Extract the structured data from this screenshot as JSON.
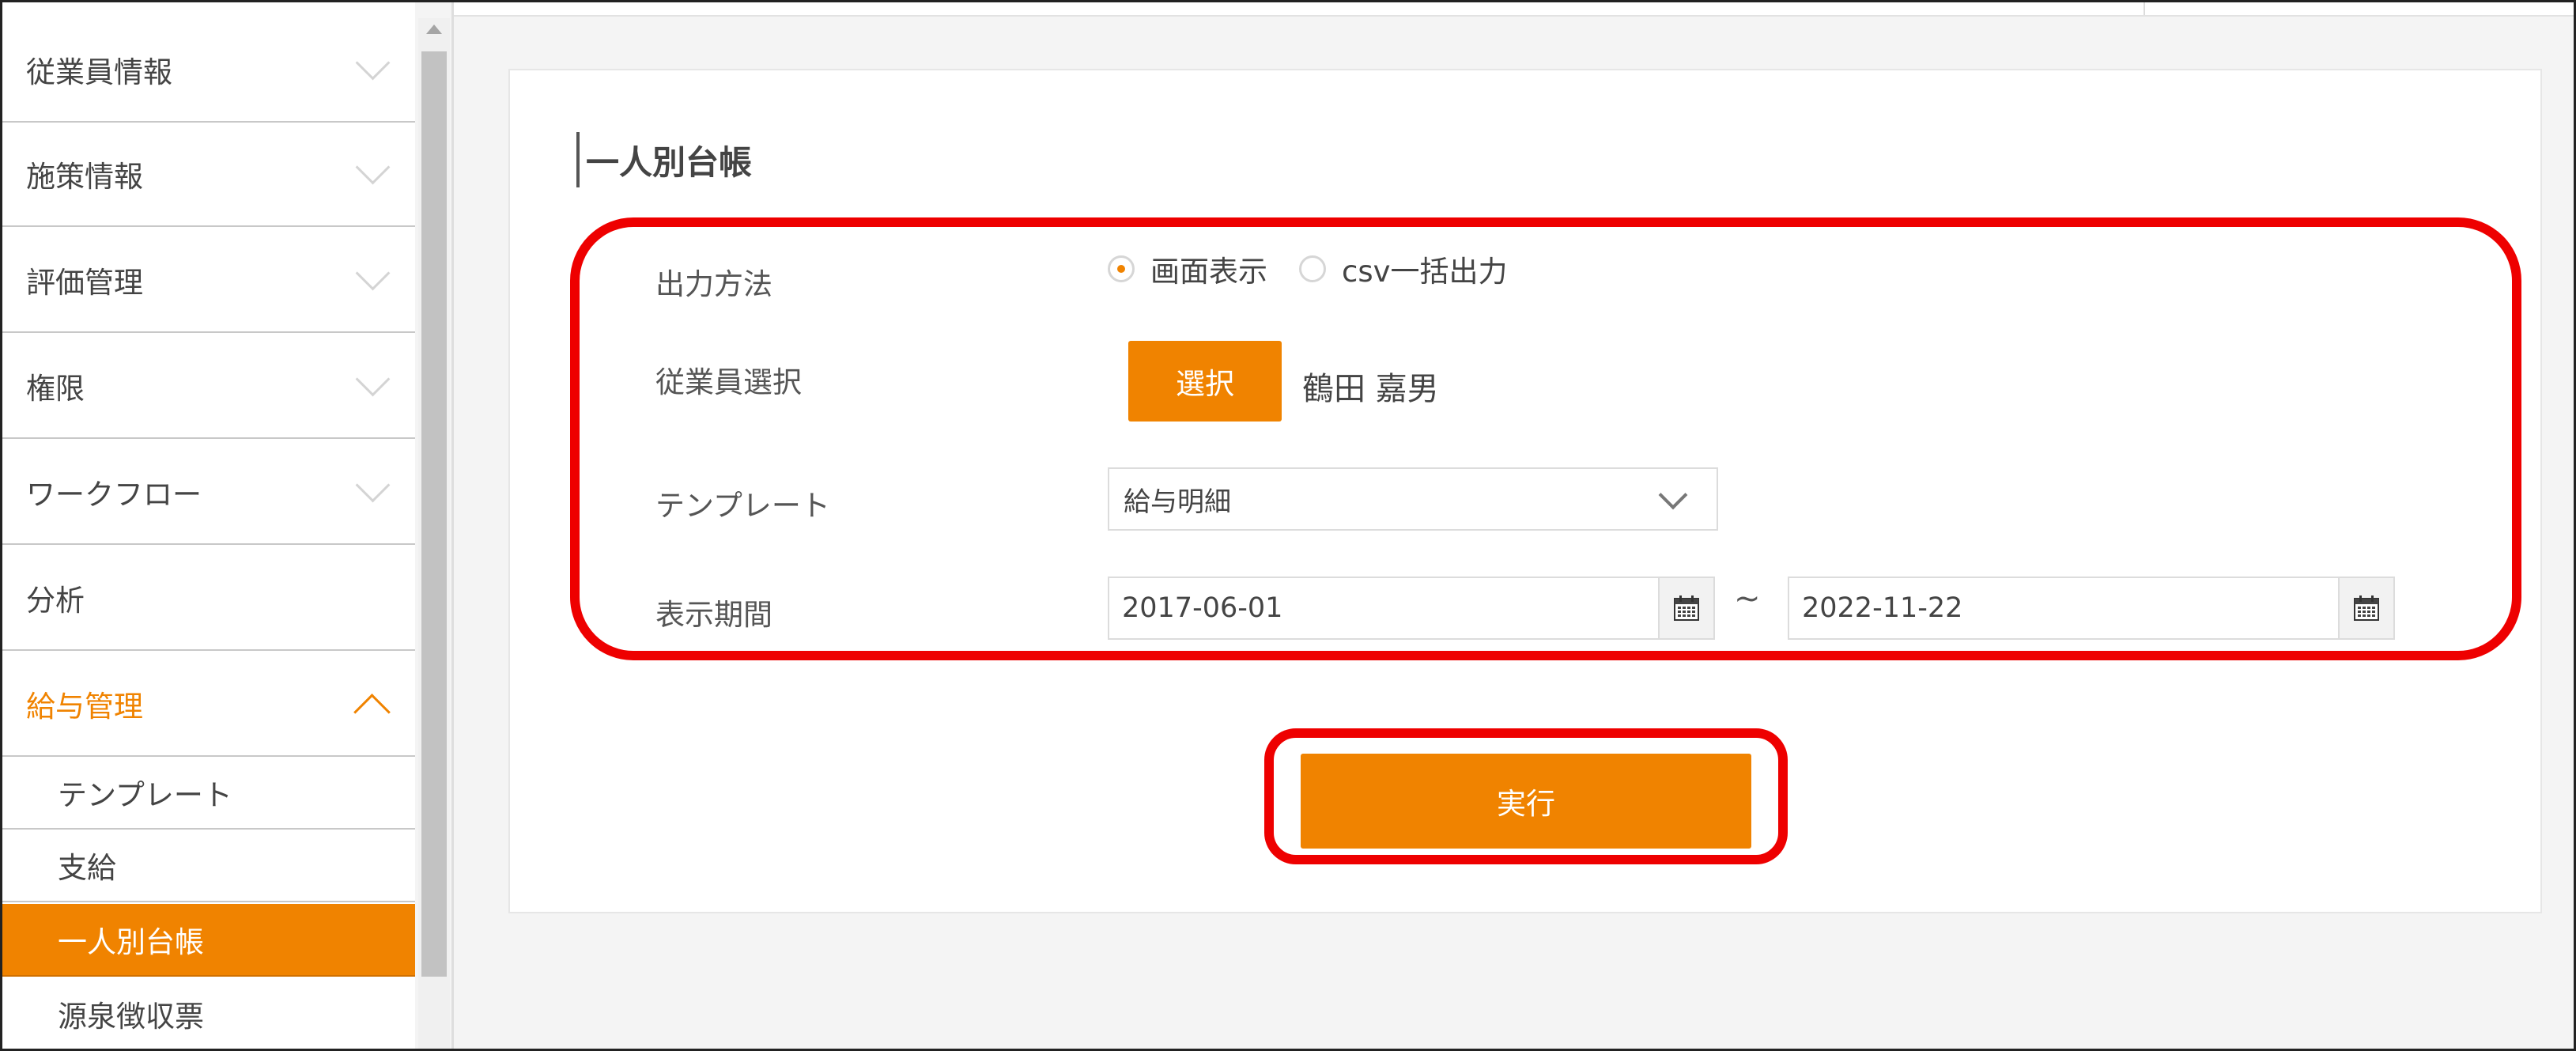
{
  "sidebar": {
    "menu": [
      {
        "label": "従業員情報"
      },
      {
        "label": "施策情報"
      },
      {
        "label": "評価管理"
      },
      {
        "label": "権限"
      },
      {
        "label": "ワークフロー"
      },
      {
        "label": "分析"
      },
      {
        "label": "給与管理"
      }
    ],
    "submenu": [
      {
        "label": "テンプレート"
      },
      {
        "label": "支給"
      },
      {
        "label": "一人別台帳"
      },
      {
        "label": "源泉徴収票"
      }
    ]
  },
  "page": {
    "title": "一人別台帳"
  },
  "form": {
    "output_method": {
      "label": "出力方法",
      "options": [
        "画面表示",
        "csv一括出力"
      ],
      "selected": "画面表示"
    },
    "employee": {
      "label": "従業員選択",
      "button_label": "選択",
      "selected_name": "鶴田 嘉男"
    },
    "template": {
      "label": "テンプレート",
      "value": "給与明細"
    },
    "period": {
      "label": "表示期間",
      "start": "2017-06-01",
      "separator": "~",
      "end": "2022-11-22"
    },
    "run_label": "実行"
  },
  "colors": {
    "accent": "#f08300",
    "highlight": "#ee0000"
  }
}
